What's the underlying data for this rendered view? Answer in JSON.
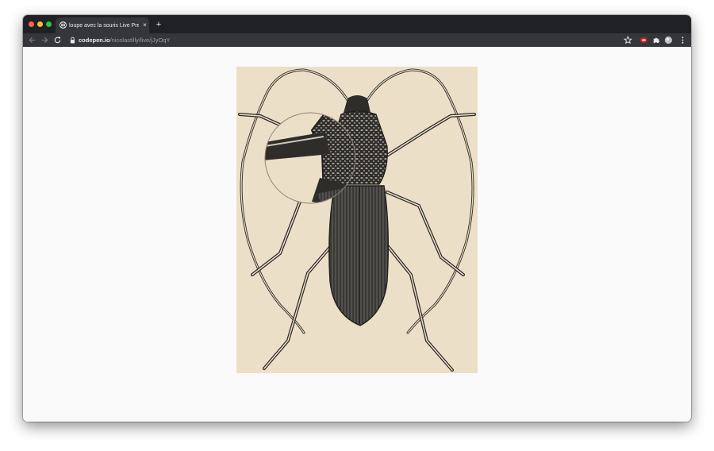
{
  "browser": {
    "tab": {
      "title": "loupe avec la souris Live Preview",
      "close_label": "×",
      "favicon": "codepen-icon"
    },
    "new_tab_label": "+",
    "address": {
      "host": "codepen.io",
      "path": "/nicolastilly/live/jJyOqY"
    },
    "toolbar_icons": [
      "back-arrow-icon",
      "forward-arrow-icon",
      "reload-icon",
      "lock-icon",
      "star-icon",
      "extension-icon",
      "puzzle-icon",
      "avatar-icon",
      "kebab-menu-icon"
    ]
  },
  "colors": {
    "titlebar": "#202124",
    "toolbar": "#35363a",
    "page_background": "#fafafa",
    "plate_background": "#ecdfc7",
    "ink": "#2b2a28"
  },
  "content": {
    "image": "engraved-longhorn-beetle",
    "loupe": "magnifier-circle"
  }
}
